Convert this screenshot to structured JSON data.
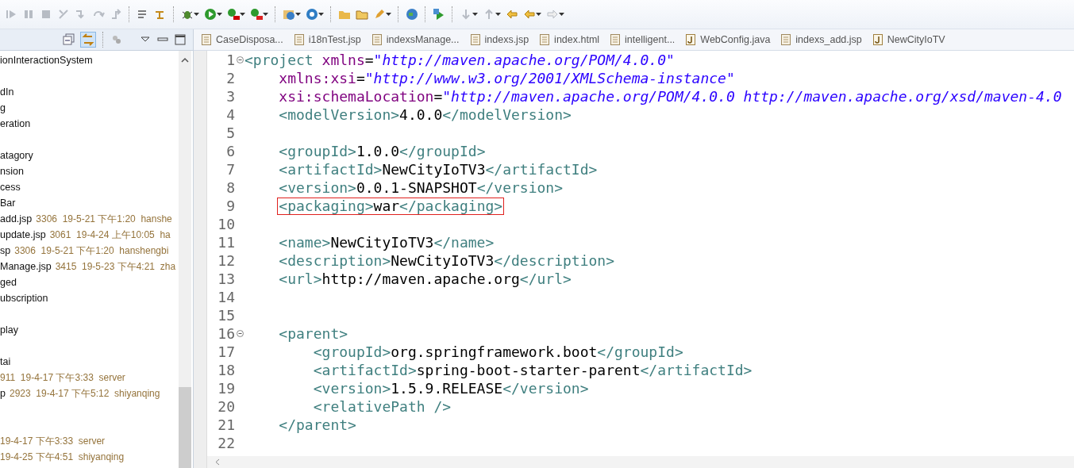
{
  "explorer": {
    "link_with_editor": true,
    "items": [
      {
        "kind": "node",
        "label": "ionInteractionSystem"
      },
      {
        "kind": "blank"
      },
      {
        "kind": "node",
        "label": "dIn"
      },
      {
        "kind": "node",
        "label": "g"
      },
      {
        "kind": "node",
        "label": "eration"
      },
      {
        "kind": "blank"
      },
      {
        "kind": "node",
        "label": "atagory"
      },
      {
        "kind": "node",
        "label": "nsion"
      },
      {
        "kind": "node",
        "label": "cess"
      },
      {
        "kind": "node",
        "label": "Bar"
      },
      {
        "kind": "node",
        "label": "add.jsp",
        "decoration": "3306  19-5-21 下午1:20  hanshe"
      },
      {
        "kind": "node",
        "label": "update.jsp",
        "decoration": "3061  19-4-24 上午10:05  ha"
      },
      {
        "kind": "node",
        "label": "sp",
        "decoration": "3306  19-5-21 下午1:20  hanshengbi"
      },
      {
        "kind": "node",
        "label": "Manage.jsp",
        "decoration": "3415  19-5-23 下午4:21  zha"
      },
      {
        "kind": "node",
        "label": "ged"
      },
      {
        "kind": "node",
        "label": "ubscription"
      },
      {
        "kind": "blank"
      },
      {
        "kind": "node",
        "label": "play"
      },
      {
        "kind": "blank"
      },
      {
        "kind": "node",
        "label": "tai"
      },
      {
        "kind": "node",
        "decoration": "911  19-4-17 下午3:33  server"
      },
      {
        "kind": "node",
        "label": "p",
        "decoration": "2923  19-4-17 下午5:12  shiyanqing"
      },
      {
        "kind": "blank"
      },
      {
        "kind": "blank"
      },
      {
        "kind": "node",
        "decoration": "19-4-17 下午3:33  server"
      },
      {
        "kind": "node",
        "decoration": "19-4-25 下午4:51  shiyanqing"
      }
    ]
  },
  "tabs": [
    {
      "label": "CaseDisposa...",
      "kind": "file"
    },
    {
      "label": "i18nTest.jsp",
      "kind": "file"
    },
    {
      "label": "indexsManage...",
      "kind": "file"
    },
    {
      "label": "indexs.jsp",
      "kind": "file"
    },
    {
      "label": "index.html",
      "kind": "file"
    },
    {
      "label": "intelligent...",
      "kind": "file"
    },
    {
      "label": "WebConfig.java",
      "kind": "java"
    },
    {
      "label": "indexs_add.jsp",
      "kind": "file"
    },
    {
      "label": "NewCityIoTV",
      "kind": "java"
    }
  ],
  "editor": {
    "lines": [
      {
        "number": "1",
        "text": "<project xmlns=\"http://maven.apache.org/POM/4.0.0\"",
        "fold": true,
        "boxed": false
      },
      {
        "number": "2",
        "text": "    xmlns:xsi=\"http://www.w3.org/2001/XMLSchema-instance\"",
        "fold": false,
        "boxed": false
      },
      {
        "number": "3",
        "text": "    xsi:schemaLocation=\"http://maven.apache.org/POM/4.0.0 http://maven.apache.org/xsd/maven-4.0",
        "fold": false,
        "boxed": false
      },
      {
        "number": "4",
        "text": "    <modelVersion>4.0.0</modelVersion>",
        "fold": false,
        "boxed": false
      },
      {
        "number": "5",
        "fold": false,
        "boxed": false
      },
      {
        "number": "6",
        "text": "    <groupId>1.0.0</groupId>",
        "fold": false,
        "boxed": false
      },
      {
        "number": "7",
        "text": "    <artifactId>NewCityIoTV3</artifactId>",
        "fold": false,
        "boxed": false
      },
      {
        "number": "8",
        "text": "    <version>0.0.1-SNAPSHOT</version>",
        "fold": false,
        "boxed": false
      },
      {
        "number": "9",
        "text": "    <packaging>war</packaging>",
        "fold": false,
        "boxed": true
      },
      {
        "number": "10",
        "fold": false,
        "boxed": false
      },
      {
        "number": "11",
        "text": "    <name>NewCityIoTV3</name>",
        "fold": false,
        "boxed": false
      },
      {
        "number": "12",
        "text": "    <description>NewCityIoTV3</description>",
        "fold": false,
        "boxed": false
      },
      {
        "number": "13",
        "text": "    <url>http://maven.apache.org</url>",
        "fold": false,
        "boxed": false
      },
      {
        "number": "14",
        "fold": false,
        "boxed": false
      },
      {
        "number": "15",
        "fold": false,
        "boxed": false
      },
      {
        "number": "16",
        "text": "    <parent>",
        "fold": true,
        "boxed": false
      },
      {
        "number": "17",
        "text": "        <groupId>org.springframework.boot</groupId>",
        "fold": false,
        "boxed": false
      },
      {
        "number": "18",
        "text": "        <artifactId>spring-boot-starter-parent</artifactId>",
        "fold": false,
        "boxed": false
      },
      {
        "number": "19",
        "text": "        <version>1.5.9.RELEASE</version>",
        "fold": false,
        "boxed": false
      },
      {
        "number": "20",
        "text": "        <relativePath />",
        "fold": false,
        "boxed": false
      },
      {
        "number": "21",
        "text": "    </parent>",
        "fold": false,
        "boxed": false
      },
      {
        "number": "22",
        "fold": false,
        "boxed": false
      }
    ]
  }
}
